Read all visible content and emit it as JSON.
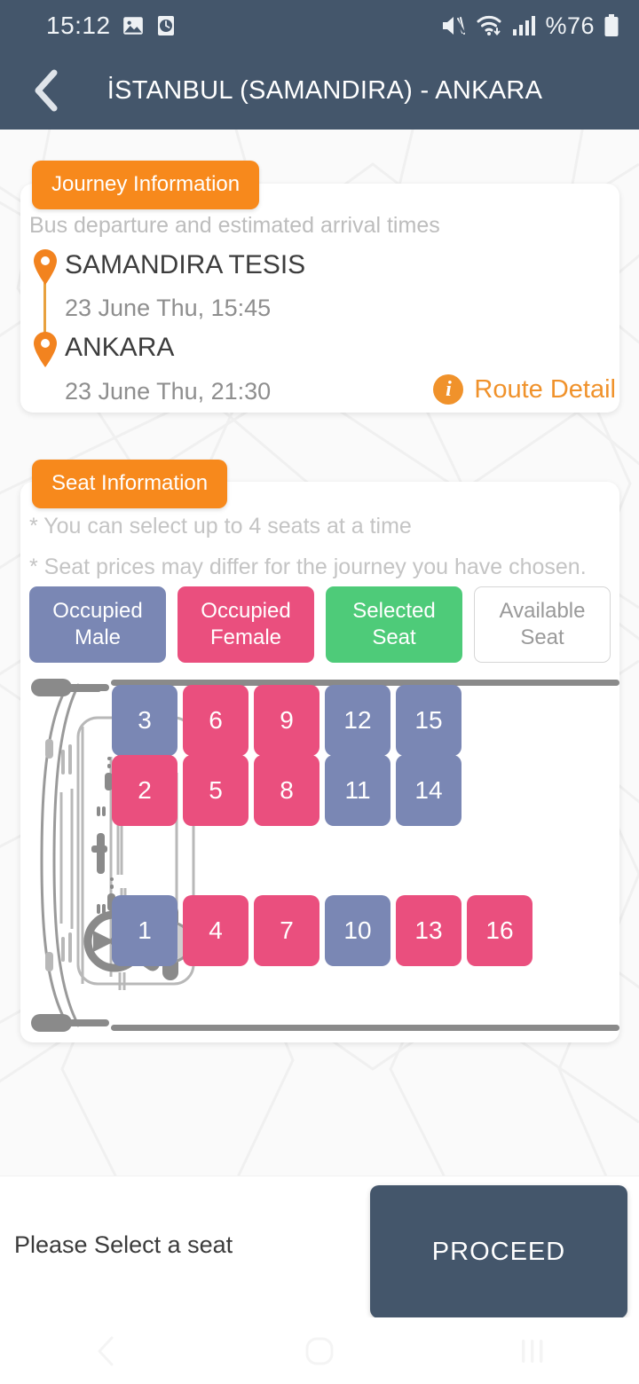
{
  "statusbar": {
    "time": "15:12",
    "battery_text": "%76",
    "icons": [
      "gallery-icon",
      "alarm-clock-icon",
      "mute-icon",
      "wifi-icon",
      "cellular-signal-icon",
      "battery-icon"
    ]
  },
  "header": {
    "title": "İSTANBUL (SAMANDIRA) - ANKARA",
    "back_icon": "chevron-left-icon"
  },
  "journey": {
    "badge": "Journey Information",
    "subtitle": "Bus departure and estimated arrival times",
    "origin": {
      "name": "SAMANDIRA TESIS",
      "time": "23 June Thu, 15:45"
    },
    "destination": {
      "name": "ANKARA",
      "time": "23 June Thu, 21:30"
    },
    "route_detail_label": "Route Detail"
  },
  "seat_section": {
    "badge": "Seat Information",
    "note1": "* You can select up to 4 seats at a time",
    "note2": "* Seat prices may differ for the journey you have chosen.",
    "legend": [
      {
        "line1": "Occupied",
        "line2": "Male",
        "state": "male",
        "color": "#7a87b4"
      },
      {
        "line1": "Occupied",
        "line2": "Female",
        "state": "female",
        "color": "#ea4f7e"
      },
      {
        "line1": "Selected",
        "line2": "Seat",
        "state": "selected",
        "color": "#4ecb79"
      },
      {
        "line1": "Available",
        "line2": "Seat",
        "state": "available",
        "color": "#ffffff"
      }
    ],
    "seats": [
      {
        "number": "3",
        "state": "male",
        "col": 0,
        "row": 0
      },
      {
        "number": "6",
        "state": "female",
        "col": 1,
        "row": 0
      },
      {
        "number": "9",
        "state": "female",
        "col": 2,
        "row": 0
      },
      {
        "number": "12",
        "state": "male",
        "col": 3,
        "row": 0
      },
      {
        "number": "15",
        "state": "male",
        "col": 4,
        "row": 0
      },
      {
        "number": "2",
        "state": "female",
        "col": 0,
        "row": 1
      },
      {
        "number": "5",
        "state": "female",
        "col": 1,
        "row": 1
      },
      {
        "number": "8",
        "state": "female",
        "col": 2,
        "row": 1
      },
      {
        "number": "11",
        "state": "male",
        "col": 3,
        "row": 1
      },
      {
        "number": "14",
        "state": "male",
        "col": 4,
        "row": 1
      },
      {
        "number": "1",
        "state": "male",
        "col": 0,
        "row": 3
      },
      {
        "number": "4",
        "state": "female",
        "col": 1,
        "row": 3
      },
      {
        "number": "7",
        "state": "female",
        "col": 2,
        "row": 3
      },
      {
        "number": "10",
        "state": "male",
        "col": 3,
        "row": 3
      },
      {
        "number": "13",
        "state": "female",
        "col": 4,
        "row": 3
      },
      {
        "number": "16",
        "state": "female",
        "col": 5,
        "row": 3
      }
    ]
  },
  "bottom": {
    "message": "Please Select a seat",
    "proceed_label": "PROCEED"
  },
  "navbar": {
    "back_icon": "nav-back-icon",
    "home_icon": "nav-home-icon",
    "recents_icon": "nav-recents-icon"
  },
  "colors": {
    "header": "#44566b",
    "accent_orange": "#f7891c",
    "link_orange": "#f0922b",
    "occupied_male": "#7a87b4",
    "occupied_female": "#ea4f7e",
    "selected_seat": "#4ecb79"
  }
}
